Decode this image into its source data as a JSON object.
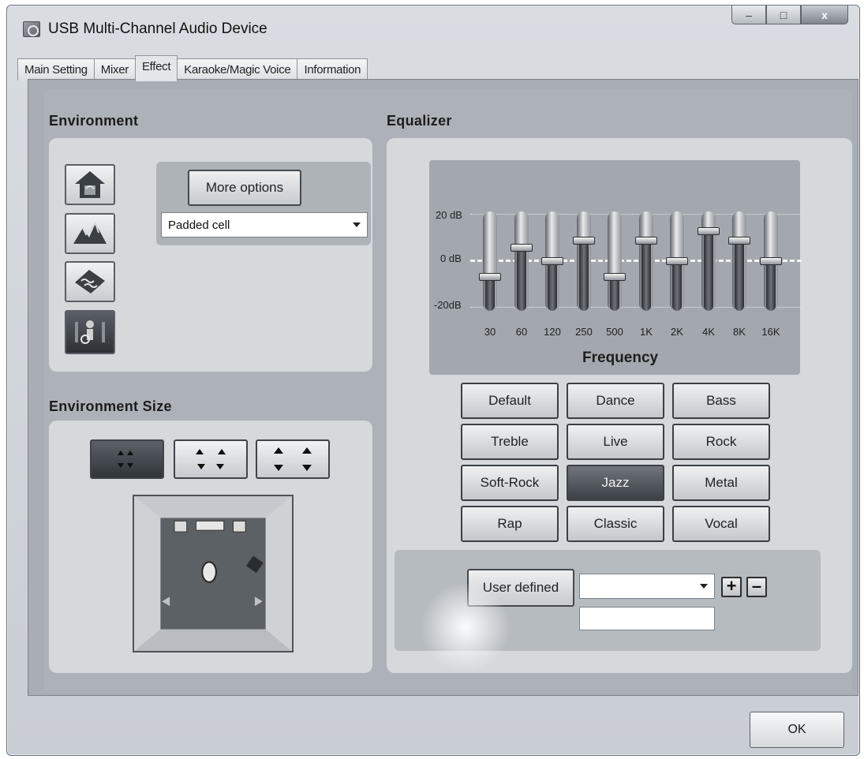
{
  "window": {
    "title": "USB Multi-Channel Audio Device",
    "controls": {
      "minimize": "–",
      "maximize": "□",
      "close": "x"
    }
  },
  "tabs": [
    {
      "label": "Main Setting",
      "active": false
    },
    {
      "label": "Mixer",
      "active": false
    },
    {
      "label": "Effect",
      "active": true
    },
    {
      "label": "Karaoke/Magic Voice",
      "active": false
    },
    {
      "label": "Information",
      "active": false
    }
  ],
  "environment": {
    "title": "Environment",
    "icons": [
      {
        "name": "house-icon",
        "selected": false
      },
      {
        "name": "mountains-icon",
        "selected": false
      },
      {
        "name": "water-icon",
        "selected": false
      },
      {
        "name": "room-icon",
        "selected": true
      }
    ],
    "more_options_label": "More options",
    "preset_value": "Padded cell"
  },
  "environment_size": {
    "title": "Environment Size",
    "options": [
      "small-room",
      "medium-room",
      "large-room"
    ],
    "selected_index": 0
  },
  "equalizer": {
    "title": "Equalizer",
    "db_labels": {
      "top": "20 dB",
      "mid": "0 dB",
      "bottom": "-20dB"
    },
    "x_title": "Frequency",
    "bands": [
      {
        "freq": "30",
        "db": -7
      },
      {
        "freq": "60",
        "db": 6
      },
      {
        "freq": "120",
        "db": 0
      },
      {
        "freq": "250",
        "db": 9
      },
      {
        "freq": "500",
        "db": -7
      },
      {
        "freq": "1K",
        "db": 9
      },
      {
        "freq": "2K",
        "db": 0
      },
      {
        "freq": "4K",
        "db": 13
      },
      {
        "freq": "8K",
        "db": 9
      },
      {
        "freq": "16K",
        "db": 0
      }
    ],
    "range": [
      -20,
      20
    ],
    "presets": [
      [
        "Default",
        "Dance",
        "Bass"
      ],
      [
        "Treble",
        "Live",
        "Rock"
      ],
      [
        "Soft-Rock",
        "Jazz",
        "Metal"
      ],
      [
        "Rap",
        "Classic",
        "Vocal"
      ]
    ],
    "active_preset": "Jazz",
    "user_defined_label": "User defined",
    "user_defined_value": "",
    "name_field_value": "",
    "plus_label": "+",
    "minus_label": "–"
  },
  "ok_label": "OK",
  "colors": {
    "panel": "#a8aeb4",
    "box": "#d6d9dc",
    "eq_area": "#a2a8ae"
  }
}
